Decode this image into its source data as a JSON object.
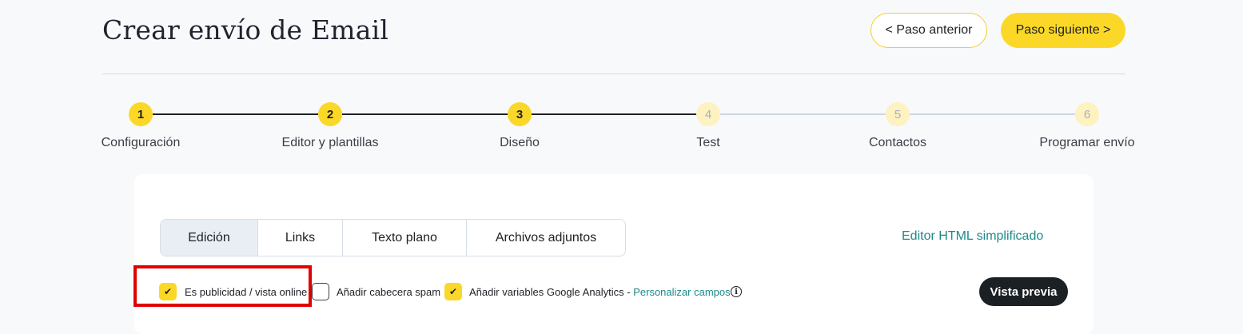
{
  "header": {
    "title": "Crear envío de Email",
    "prev_label": "< Paso anterior",
    "next_label": "Paso siguiente >"
  },
  "stepper": {
    "steps": [
      {
        "number": "1",
        "label": "Configuración",
        "state": "done"
      },
      {
        "number": "2",
        "label": "Editor y plantillas",
        "state": "done"
      },
      {
        "number": "3",
        "label": "Diseño",
        "state": "current"
      },
      {
        "number": "4",
        "label": "Test",
        "state": "pending"
      },
      {
        "number": "5",
        "label": "Contactos",
        "state": "pending"
      },
      {
        "number": "6",
        "label": "Programar envío",
        "state": "pending"
      }
    ]
  },
  "tabs": [
    {
      "label": "Edición",
      "active": true
    },
    {
      "label": "Links",
      "active": false
    },
    {
      "label": "Texto plano",
      "active": false
    },
    {
      "label": "Archivos adjuntos",
      "active": false
    }
  ],
  "html_editor_link": "Editor HTML simplificado",
  "options": [
    {
      "label": "Es publicidad / vista online",
      "checked": true
    },
    {
      "label": "Añadir cabecera spam",
      "checked": false
    },
    {
      "label": "Añadir variables Google Analytics - ",
      "checked": true
    }
  ],
  "customize_link": "Personalizar campos",
  "info_icon": "i",
  "check_mark": "✔",
  "preview_label": "Vista previa",
  "colors": {
    "accent_yellow": "#fbd827",
    "link_teal": "#1c8a8a",
    "highlight_red": "#e00000",
    "dark_button": "#1b2024"
  }
}
